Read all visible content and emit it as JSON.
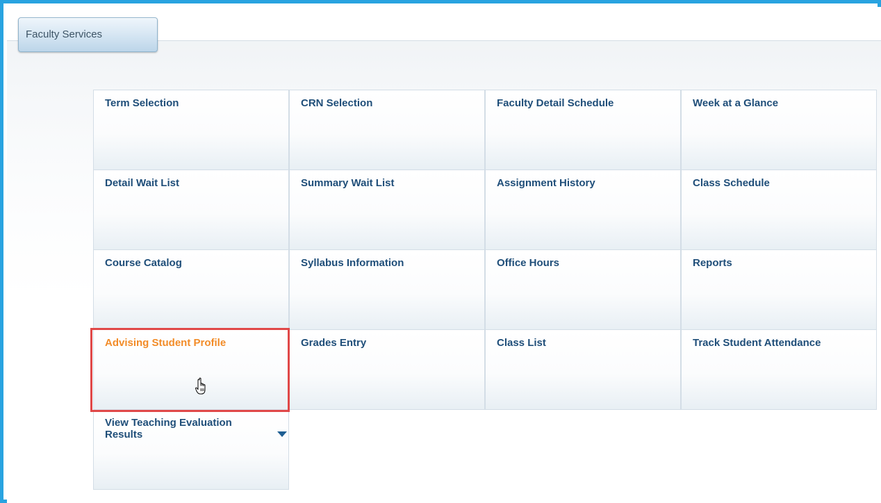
{
  "tab": {
    "label": "Faculty Services"
  },
  "tiles": [
    {
      "label": "Term Selection"
    },
    {
      "label": "CRN Selection"
    },
    {
      "label": "Faculty Detail Schedule"
    },
    {
      "label": "Week at a Glance"
    },
    {
      "label": "Detail Wait List"
    },
    {
      "label": "Summary Wait List"
    },
    {
      "label": "Assignment History"
    },
    {
      "label": "Class Schedule"
    },
    {
      "label": "Course Catalog"
    },
    {
      "label": "Syllabus Information"
    },
    {
      "label": "Office Hours"
    },
    {
      "label": "Reports"
    },
    {
      "label": "Advising Student Profile"
    },
    {
      "label": "Grades Entry"
    },
    {
      "label": "Class List"
    },
    {
      "label": "Track Student Attendance"
    },
    {
      "label": "View Teaching Evaluation Results"
    }
  ],
  "colors": {
    "frame_border": "#29a3e0",
    "tile_label": "#1f4e79",
    "active_label": "#f28c28",
    "highlight_box": "#e04848"
  }
}
